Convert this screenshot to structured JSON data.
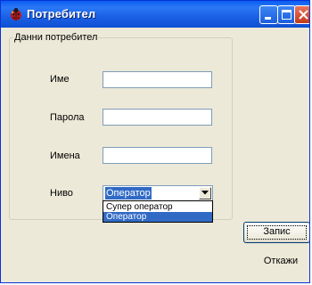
{
  "window": {
    "title": "Потребител",
    "icon": "ladybug-icon"
  },
  "title_buttons": {
    "minimize": "minimize-icon",
    "maximize": "maximize-icon",
    "close": "close-icon"
  },
  "group": {
    "legend": "Данни потребител"
  },
  "fields": {
    "name": {
      "label": "Име",
      "value": ""
    },
    "password": {
      "label": "Парола",
      "value": ""
    },
    "names": {
      "label": "Имена",
      "value": ""
    }
  },
  "level": {
    "label": "Ниво",
    "selected": "Оператор",
    "options": [
      "Супер оператор",
      "Оператор"
    ]
  },
  "buttons": {
    "save": "Запис",
    "cancel": "Откажи"
  },
  "colors": {
    "titlebar": "#1c63e8",
    "selection": "#316ac5",
    "window_bg": "#ece9d8"
  }
}
